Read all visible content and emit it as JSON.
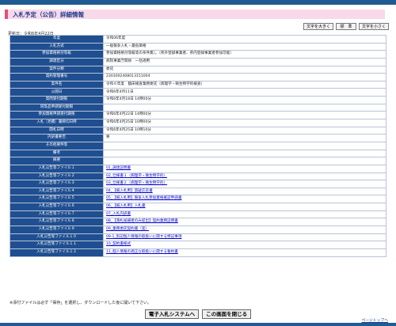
{
  "page": {
    "title": "入札予定（公告）詳細情報",
    "updated": "更新日：令和6年4月22日",
    "font_buttons": [
      "文字を大きく",
      "標　準",
      "文字を小さく"
    ],
    "note": "※添付ファイルは必ず「保存」を選択し、ダウンロードした後に開いて下さい。",
    "bottom_buttons": [
      "電子入札システムへ",
      "この画面を閉じる"
    ],
    "page_top": "ページトップへ"
  },
  "rows": [
    {
      "label": "年度",
      "value": "令和06年度"
    },
    {
      "label": "入札方式",
      "value": "一般競争入札・最低価格"
    },
    {
      "label": "参加資格格付等級",
      "value": "参加資格格付等級等の条件無し（県外登録事業者、県内登録事業者参加可能）"
    },
    {
      "label": "調達区分",
      "value": "病院事業庁関係　一括適用"
    },
    {
      "label": "案件分類",
      "value": "委託"
    },
    {
      "label": "契約管理番号",
      "value": "2303002408013151004"
    },
    {
      "label": "案件名",
      "value": "令和６年度　臨床検査業務委託（病理学・微生物学的検査）"
    },
    {
      "label": "公開日",
      "value": "令和6年4月11日"
    },
    {
      "label": "質問受付期限",
      "value": "令和6年4月18日 14時00分"
    },
    {
      "label": "同等品申請受付期限",
      "value": ""
    },
    {
      "label": "参加資格申請受付期限",
      "value": "令和6年4月22日 14時00分"
    },
    {
      "label": "入札（見積）書締切日時",
      "value": "令和6年4月25日 10時00分"
    },
    {
      "label": "開札日時",
      "value": "令和6年4月25日 10時10分"
    },
    {
      "label": "内訳書要否",
      "value": "要"
    },
    {
      "label": "その他要件等",
      "value": ""
    },
    {
      "label": "備考",
      "value": ""
    },
    {
      "label": "摘要",
      "value": ""
    },
    {
      "label": "入札公告等ファイル１",
      "value": "01_調達説明書",
      "link": true
    },
    {
      "label": "入札公告等ファイル２",
      "value": "02_仕様書１（病理学・微生物学的）",
      "link": true
    },
    {
      "label": "入札公告等ファイル３",
      "value": "03_仕様書２（病理学・微生物学的）",
      "link": true
    },
    {
      "label": "入札公告等ファイル４",
      "value": "04_【紙入札用】質疑応答書",
      "link": true
    },
    {
      "label": "入札公告等ファイル５",
      "value": "05_【紙入札用】競争入札参加資格確認申請書",
      "link": true
    },
    {
      "label": "入札公告等ファイル６",
      "value": "06_【紙入札用】入札書",
      "link": true
    },
    {
      "label": "入札公告等ファイル７",
      "value": "07_入札内訳書",
      "link": true
    },
    {
      "label": "入札公告等ファイル８",
      "value": "08_【落札候補者のみ提出】契約業務証明書",
      "link": true
    },
    {
      "label": "入札公告等ファイル９",
      "value": "09_業務委託契約書（案）",
      "link": true
    },
    {
      "label": "入札公告等ファイル１０",
      "value": "09-1_別記個人情報の取扱いに関する特記事項",
      "link": true
    },
    {
      "label": "入札公告等ファイル１１",
      "value": "10_契約書様式",
      "link": true
    },
    {
      "label": "入札公告等ファイル１２",
      "value": "11_個人情報の適正な取扱いに関する誓約書",
      "link": true
    }
  ]
}
